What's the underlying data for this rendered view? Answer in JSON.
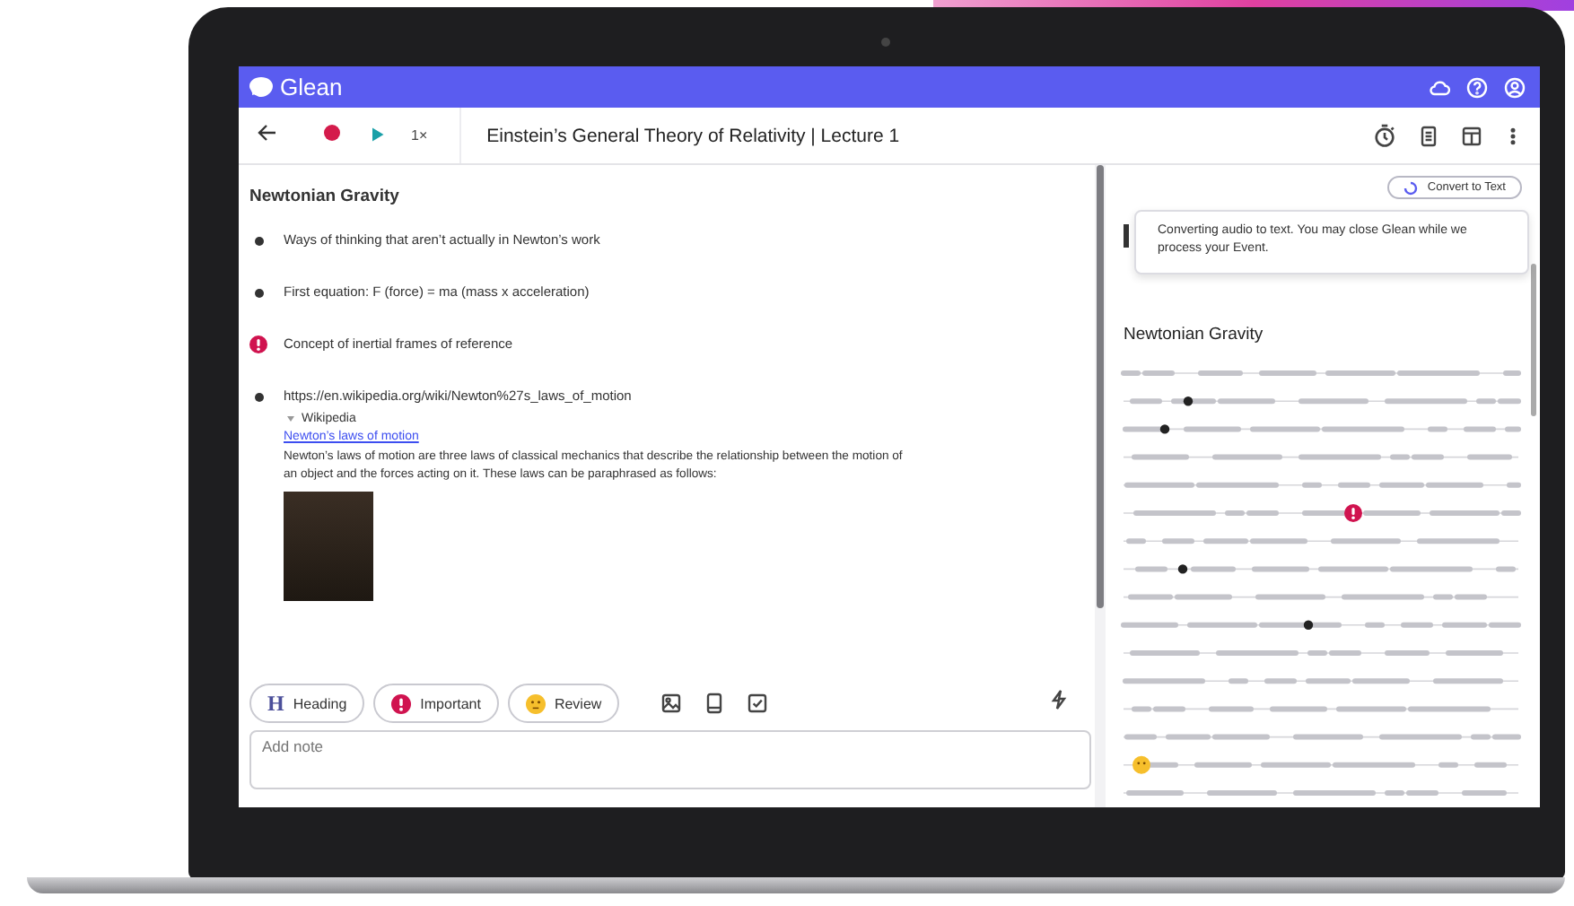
{
  "app": {
    "name": "Glean"
  },
  "toolbar": {
    "speed": "1×",
    "title": "Einstein’s General Theory of Relativity | Lecture 1"
  },
  "notes": {
    "heading": "Newtonian Gravity",
    "items": [
      {
        "kind": "bullet",
        "text": "Ways of thinking that aren’t actually in Newton’s work"
      },
      {
        "kind": "bullet",
        "text": "First equation: F (force) = ma (mass x acceleration)"
      },
      {
        "kind": "important",
        "text": "Concept of inertial frames of reference"
      },
      {
        "kind": "link",
        "text": "https://en.wikipedia.org/wiki/Newton%27s_laws_of_motion",
        "preview": {
          "source": "Wikipedia",
          "expanded": true,
          "title": "Newton’s laws of motion",
          "summary": "Newton’s laws of motion are three laws of classical mechanics that describe the relationship between the motion of an object and the forces acting on it. These laws can be paraphrased as follows:"
        }
      }
    ]
  },
  "note_toolbar": {
    "chips": [
      {
        "kind": "heading",
        "icon": "H",
        "label": "Heading"
      },
      {
        "kind": "important",
        "label": "Important"
      },
      {
        "kind": "review",
        "label": "Review"
      }
    ]
  },
  "note_field": {
    "placeholder": "Add note"
  },
  "transcript": {
    "convert_button": "Convert to Text",
    "notice": "Converting audio to text. You may close Glean while we process your Event.",
    "heading": "Newtonian Gravity"
  }
}
